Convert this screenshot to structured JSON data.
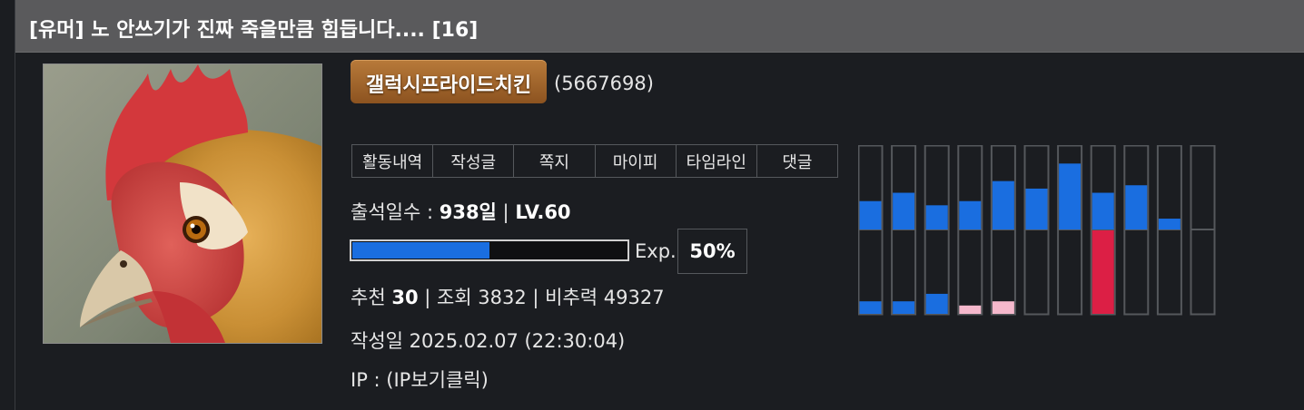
{
  "post": {
    "title": "[유머] 노 안쓰기가 진짜 죽을만큼 힘듭니다.... [16]"
  },
  "author": {
    "nickname": "갤럭시프라이드치킨",
    "user_id": "(5667698)"
  },
  "tabs": [
    "활동내역",
    "작성글",
    "쪽지",
    "마이피",
    "타임라인",
    "댓글"
  ],
  "stats": {
    "attendance_label": "출석일수 : ",
    "attendance_value": "938일",
    "separator": " | ",
    "level": "LV.60",
    "recommend_label": "추천 ",
    "recommend_value": "30",
    "views_text": " | 조회 3832 | 비추력 49327",
    "date_text": "작성일 2025.02.07 (22:30:04)",
    "ip_text": "IP : (IP보기클릭)"
  },
  "exp": {
    "label": "Exp.",
    "percent_text": "50%",
    "percent": 50
  },
  "colors": {
    "title_bar": "#5a5a5c",
    "background": "#1b1d21",
    "exp_fill": "#1a6ee0",
    "badge_top": "#b87a3a",
    "badge_bottom": "#8c5320",
    "chart_blue": "#1a6ee0",
    "chart_pink": "#f5b8cc",
    "chart_red": "#dc1f45"
  },
  "chart_data": {
    "type": "bar",
    "upper": [
      0.34,
      0.44,
      0.29,
      0.34,
      0.58,
      0.49,
      0.79,
      0.44,
      0.53,
      0.13,
      0
    ],
    "lower": [
      0.15,
      0.15,
      0.24,
      0.1,
      0.15,
      0,
      0,
      1.0,
      0,
      0,
      0
    ],
    "lower_colors": [
      "blue",
      "blue",
      "blue",
      "pink",
      "pink",
      "none",
      "none",
      "red",
      "none",
      "none",
      "none"
    ]
  }
}
